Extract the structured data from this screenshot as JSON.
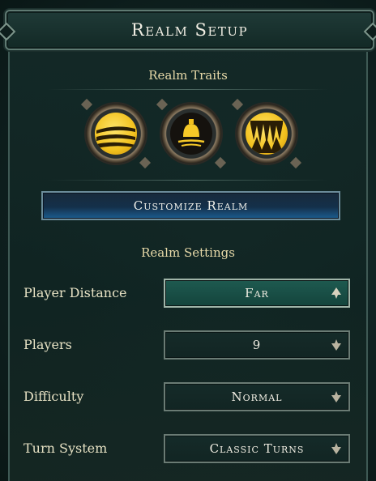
{
  "title": "Realm Setup",
  "traits": {
    "heading": "Realm Traits",
    "items": [
      {
        "icon": "wind-layers-icon"
      },
      {
        "icon": "bell-water-icon"
      },
      {
        "icon": "fanged-maw-icon"
      }
    ]
  },
  "customize_label": "Customize Realm",
  "settings": {
    "heading": "Realm Settings",
    "rows": [
      {
        "label": "Player Distance",
        "value": "Far",
        "active": true
      },
      {
        "label": "Players",
        "value": "9",
        "active": false
      },
      {
        "label": "Difficulty",
        "value": "Normal",
        "active": false
      },
      {
        "label": "Turn System",
        "value": "Classic Turns",
        "active": false
      }
    ]
  },
  "colors": {
    "accent_gold": "#f2c11e",
    "button_blue": "#1b5d8f",
    "label_text": "#e7e2c4",
    "heading_text": "#e7d9a8"
  }
}
